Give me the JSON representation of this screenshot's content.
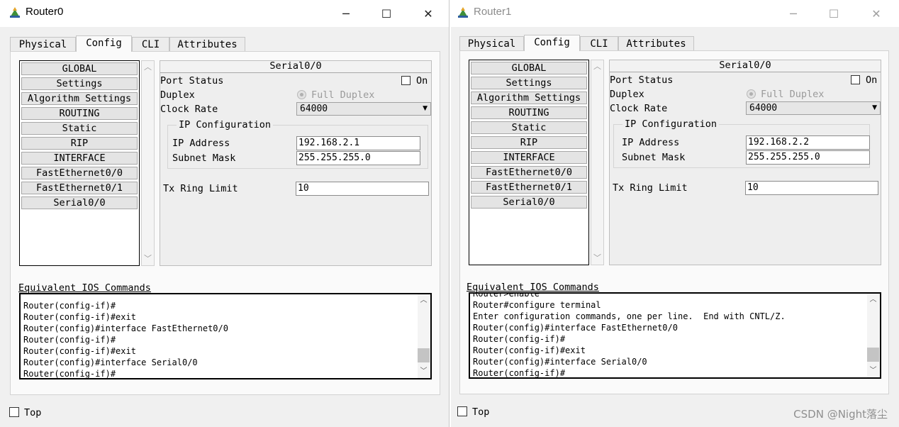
{
  "tabs": [
    "Physical",
    "Config",
    "CLI",
    "Attributes"
  ],
  "window_controls": {
    "minimize": "─",
    "maximize": "☐",
    "close": "✕"
  },
  "sidebar_items": [
    "GLOBAL",
    "Settings",
    "Algorithm Settings",
    "ROUTING",
    "Static",
    "RIP",
    "INTERFACE",
    "FastEthernet0/0",
    "FastEthernet0/1",
    "Serial0/0"
  ],
  "scroll_glyphs": {
    "up": "︿",
    "down": "﹀"
  },
  "panel": {
    "header": "Serial0/0",
    "port_status_label": "Port Status",
    "on_label": "On",
    "duplex_label": "Duplex",
    "full_duplex_label": "Full Duplex",
    "clock_rate_label": "Clock Rate",
    "clock_rate_value": "64000",
    "ip_config_label": "IP Configuration",
    "ip_address_label": "IP Address",
    "subnet_mask_label": "Subnet Mask",
    "tx_ring_label": "Tx Ring Limit"
  },
  "equivalent_label": "Equivalent IOS Commands",
  "top_label": "Top",
  "watermark": "CSDN @Night落尘",
  "router0": {
    "title": "Router0",
    "ip_address": "192.168.2.1",
    "subnet_mask": "255.255.255.0",
    "tx_ring_limit": "10",
    "console_lines": [
      "Router(config-if)#",
      "Router(config-if)#exit",
      "Router(config)#interface FastEthernet0/0",
      "Router(config-if)#",
      "Router(config-if)#exit",
      "Router(config)#interface Serial0/0",
      "Router(config-if)#"
    ]
  },
  "router1": {
    "title": "Router1",
    "ip_address": "192.168.2.2",
    "subnet_mask": "255.255.255.0",
    "tx_ring_limit": "10",
    "console_lines": [
      "Router>enable",
      "Router#configure terminal",
      "Enter configuration commands, one per line.  End with CNTL/Z.",
      "Router(config)#interface FastEthernet0/0",
      "Router(config-if)#",
      "Router(config-if)#exit",
      "Router(config)#interface Serial0/0",
      "Router(config-if)#"
    ]
  }
}
